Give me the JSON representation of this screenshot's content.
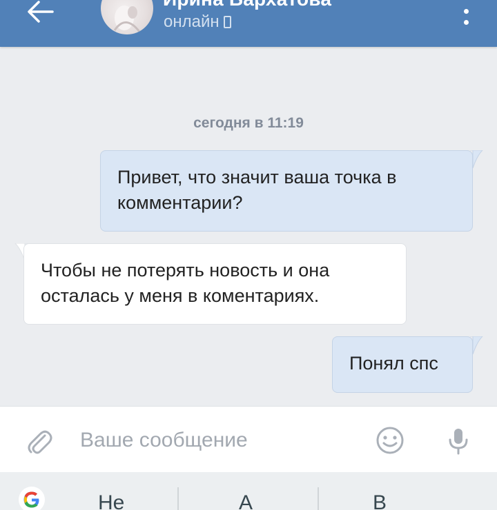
{
  "header": {
    "contact_name": "Ирина Бархатова",
    "status": "онлайн",
    "back_icon": "arrow-left-icon",
    "more_icon": "more-vertical-icon"
  },
  "chat": {
    "date_separator": "сегодня в 11:19",
    "messages": [
      {
        "direction": "out",
        "lines": [
          "Привет, что значит ваша точка в",
          "комментарии?"
        ]
      },
      {
        "direction": "in",
        "lines": [
          "Чтобы не потерять новость и она",
          "осталась у меня в коментариях."
        ]
      },
      {
        "direction": "out",
        "lines": [
          "Понял спс"
        ]
      }
    ]
  },
  "composer": {
    "placeholder": "Ваше сообщение",
    "value": "",
    "attach_icon": "paperclip-icon",
    "emoji_icon": "smiley-icon",
    "mic_icon": "microphone-icon"
  },
  "keyboard": {
    "logo_icon": "google-g-icon",
    "suggestions": [
      "Не",
      "А",
      "В"
    ]
  },
  "colors": {
    "header_bg": "#5181b8",
    "chat_bg": "#ebedf0",
    "outgoing_bubble": "#dae6f5",
    "incoming_bubble": "#ffffff"
  }
}
